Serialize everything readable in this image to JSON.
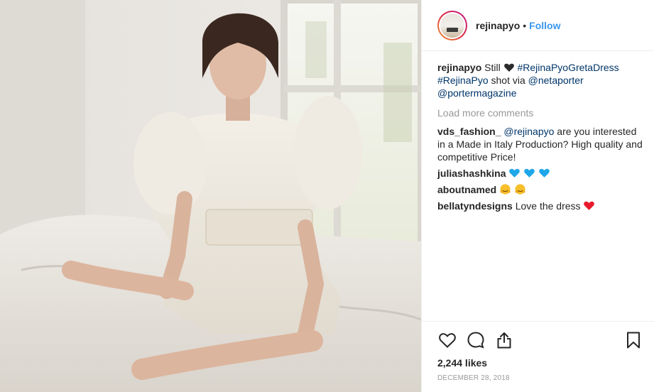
{
  "post": {
    "username": "rejinapyo",
    "separator": "•",
    "follow_label": "Follow",
    "caption": {
      "user": "rejinapyo",
      "text_before": "Still",
      "tags": [
        "#RejinaPyoGretaDress",
        "#RejinaPyo"
      ],
      "middle_text": "shot via",
      "mentions": [
        "@netaporter",
        "@portermagazine"
      ]
    },
    "load_more_label": "Load more comments",
    "comments": [
      {
        "user": "vds_fashion_",
        "mention": "@rejinapyo",
        "text": "are you interested in a Made in Italy Production? High quality and competitive Price!"
      },
      {
        "user": "juliashashkina",
        "text": "",
        "emoji": [
          "blue-heart",
          "blue-heart",
          "blue-heart"
        ]
      },
      {
        "user": "aboutnamed",
        "text": "",
        "emoji": [
          "hugging-face",
          "hugging-face"
        ]
      },
      {
        "user": "bellatyndesigns",
        "text": "Love the dress",
        "emoji": [
          "red-heart"
        ]
      }
    ],
    "likes": "2,244 likes",
    "date": "DECEMBER 28, 2018",
    "icons": [
      "heart-icon",
      "comment-icon",
      "share-icon",
      "bookmark-icon"
    ],
    "colors": {
      "link": "#003569",
      "follow": "#3897f0",
      "muted": "#999999",
      "text": "#262626"
    }
  }
}
